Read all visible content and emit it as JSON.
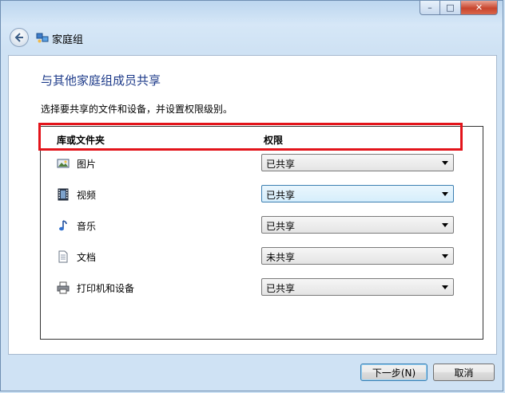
{
  "window": {
    "title_bar": {
      "minimize_symbol": "–",
      "maximize_symbol": "□",
      "close_symbol": "✕"
    },
    "address_title": "家庭组"
  },
  "content": {
    "heading": "与其他家庭组成员共享",
    "instruction": "选择要共享的文件和设备，并设置权限级别。",
    "columns": {
      "library": "库或文件夹",
      "permission": "权限"
    },
    "rows": [
      {
        "icon": "pictures-icon",
        "label": "图片",
        "permission": "已共享"
      },
      {
        "icon": "video-icon",
        "label": "视频",
        "permission": "已共享",
        "highlighted": true
      },
      {
        "icon": "music-icon",
        "label": "音乐",
        "permission": "已共享"
      },
      {
        "icon": "document-icon",
        "label": "文档",
        "permission": "未共享"
      },
      {
        "icon": "printer-icon",
        "label": "打印机和设备",
        "permission": "已共享"
      }
    ]
  },
  "buttons": {
    "next": "下一步(N)",
    "cancel": "取消"
  },
  "colors": {
    "heading": "#1e3b8a",
    "highlight_box": "#e3141b",
    "window_frame": "#cfe2f4"
  }
}
